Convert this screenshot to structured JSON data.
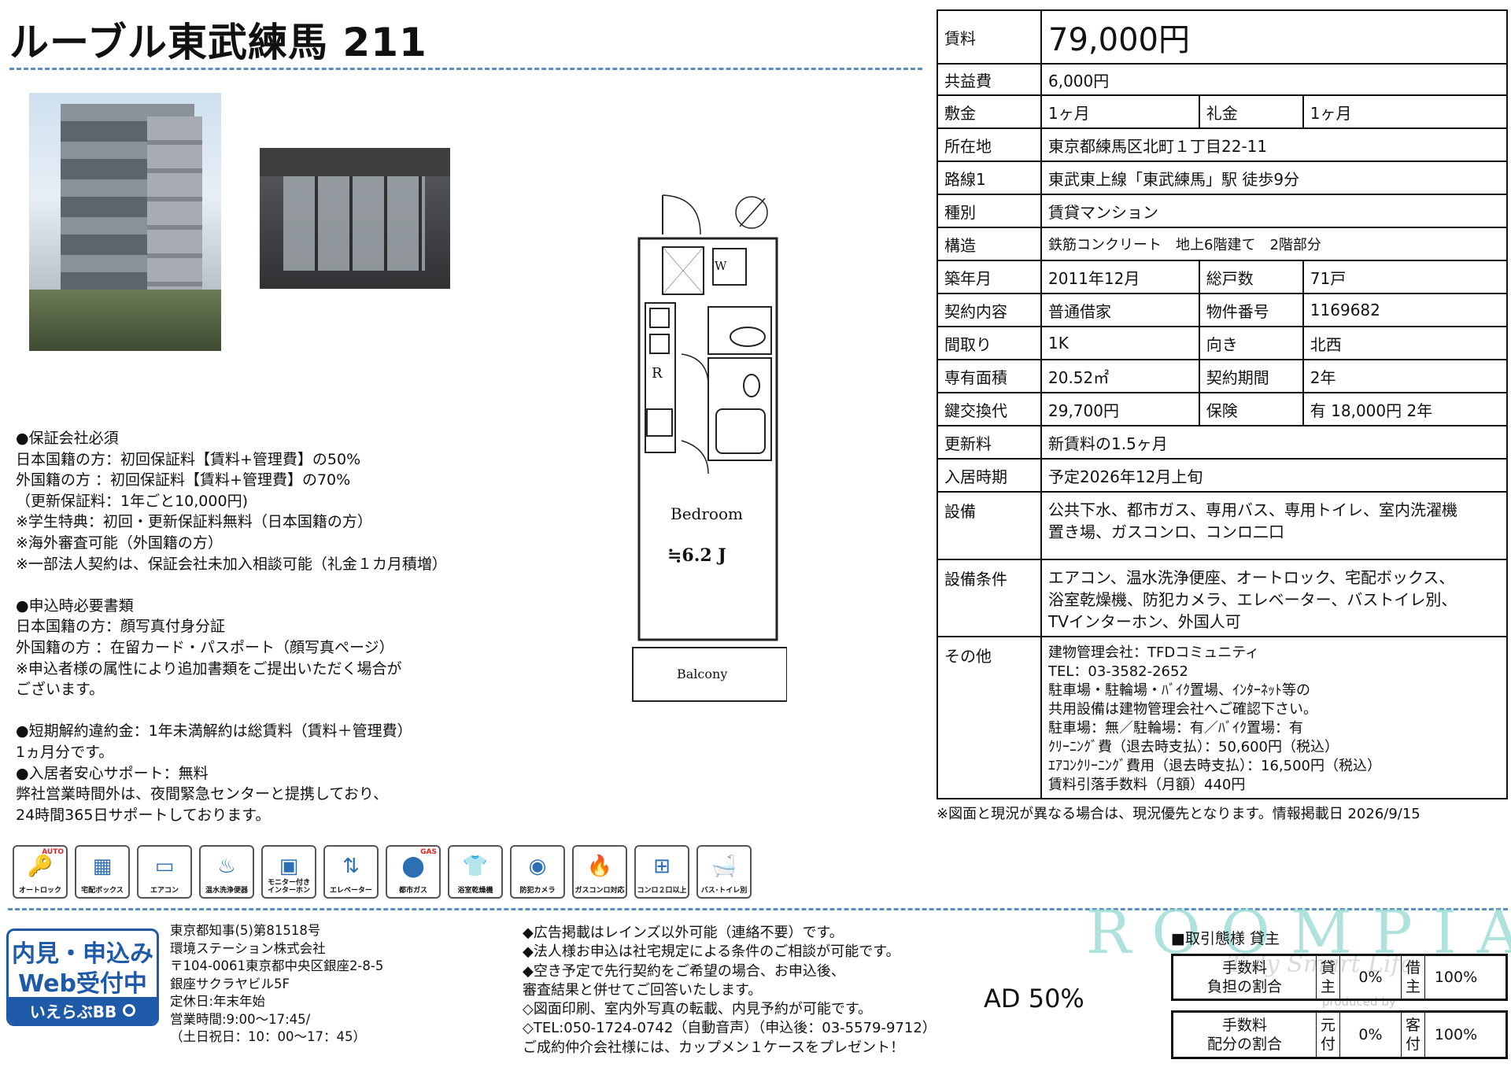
{
  "title": "ルーブル東武練馬 211",
  "specs": {
    "rent_label": "賃料",
    "rent_value": "79,000円",
    "common_fee_label": "共益費",
    "common_fee_value": "6,000円",
    "deposit_label": "敷金",
    "deposit_value": "1ヶ月",
    "key_money_label": "礼金",
    "key_money_value": "1ヶ月",
    "address_label": "所在地",
    "address_value": "東京都練馬区北町１丁目22-11",
    "route_label": "路線1",
    "route_value": "東武東上線「東武練馬」駅 徒歩9分",
    "type_label": "種別",
    "type_value": "賃貸マンション",
    "structure_label": "構造",
    "structure_value": "鉄筋コンクリート　地上6階建て　2階部分",
    "built_label": "築年月",
    "built_value": "2011年12月",
    "units_label": "総戸数",
    "units_value": "71戸",
    "contract_label": "契約内容",
    "contract_value": "普通借家",
    "property_no_label": "物件番号",
    "property_no_value": "1169682",
    "layout_label": "間取り",
    "layout_value": "1K",
    "direction_label": "向き",
    "direction_value": "北西",
    "area_label": "専有面積",
    "area_value": "20.52㎡",
    "period_label": "契約期間",
    "period_value": "2年",
    "key_exchange_label": "鍵交換代",
    "key_exchange_value": "29,700円",
    "insurance_label": "保険",
    "insurance_value": "有 18,000円 2年",
    "renewal_label": "更新料",
    "renewal_value": "新賃料の1.5ヶ月",
    "move_in_label": "入居時期",
    "move_in_value": "予定2026年12月上旬",
    "facilities_label": "設備",
    "facilities_value": "公共下水、都市ガス、専用バス、専用トイレ、室内洗濯機\n置き場、ガスコンロ、コンロ二口",
    "conditions_label": "設備条件",
    "conditions_value": "エアコン、温水洗浄便座、オートロック、宅配ボックス、\n浴室乾燥機、防犯カメラ、エレベーター、バストイレ別、\nTVインターホン、外国人可",
    "other_label": "その他",
    "other_value": "建物管理会社：TFDコミュニティ\nTEL：03-3582-2652\n駐車場・駐輪場・ﾊﾞｲｸ置場、ｲﾝﾀｰﾈｯﾄ等の\n共用設備は建物管理会社へご確認下さい。\n駐車場：無／駐輪場：有／ﾊﾞｲｸ置場：有\nｸﾘｰﾆﾝｸﾞ費（退去時支払）：50,600円（税込）\nｴｱｺﾝｸﾘｰﾆﾝｸﾞ費用（退去時支払）：16,500円（税込）\n賃料引落手数料（月額）440円"
  },
  "notice": "※図面と現況が異なる場合は、現況優先となります。情報掲載日 2026/9/15",
  "left_notes": "●保証会社必須\n日本国籍の方：初回保証料【賃料+管理費】の50%\n外国籍の方 ：初回保証料【賃料+管理費】の70%\n（更新保証料：1年ごと10,000円)\n※学生特典：初回・更新保証料無料（日本国籍の方）\n※海外審査可能（外国籍の方）\n※一部法人契約は、保証会社未加入相談可能（礼金１カ月積増）\n\n●申込時必要書類\n日本国籍の方：顔写真付身分証\n外国籍の方 ：在留カード・パスポート（顔写真ページ）\n※申込者様の属性により追加書類をご提出いただく場合が\nございます。\n\n●短期解約違約金：1年未満解約は総賃料（賃料＋管理費）\n1ヵ月分です。\n●入居者安心サポート：無料\n弊社営業時間外は、夜間緊急センターと提携しており、\n24時間365日サポートしております。",
  "floorplan": {
    "room_label": "Bedroom",
    "room_size": "≒6.2 J",
    "balcony_label": "Balcony",
    "r_label": "R",
    "w_label": "W"
  },
  "icons": [
    {
      "label": "オートロック",
      "icon": "key-icon",
      "glyph": "🔑",
      "badge": "AUTO"
    },
    {
      "label": "宅配ボックス",
      "icon": "delivery-box-icon",
      "glyph": "▦"
    },
    {
      "label": "エアコン",
      "icon": "air-conditioner-icon",
      "glyph": "▭"
    },
    {
      "label": "温水洗浄便器",
      "icon": "washlet-icon",
      "glyph": "♨"
    },
    {
      "label": "モニター付き\nインターホン",
      "icon": "intercom-icon",
      "glyph": "▣"
    },
    {
      "label": "エレベーター",
      "icon": "elevator-icon",
      "glyph": "⇅"
    },
    {
      "label": "都市ガス",
      "icon": "gas-tank-icon",
      "glyph": "⬤",
      "badge": "GAS"
    },
    {
      "label": "浴室乾燥機",
      "icon": "bath-dryer-icon",
      "glyph": "👕"
    },
    {
      "label": "防犯カメラ",
      "icon": "security-camera-icon",
      "glyph": "◉"
    },
    {
      "label": "ガスコンロ対応",
      "icon": "gas-flame-icon",
      "glyph": "🔥"
    },
    {
      "label": "コンロ２口以上",
      "icon": "stove-icon",
      "glyph": "⊞"
    },
    {
      "label": "バス･トイレ別",
      "icon": "bath-toilet-icon",
      "glyph": "🛁"
    }
  ],
  "web_badge": {
    "line1": "内見・申込み",
    "line2": "Web受付中",
    "bar": "いえらぶBB"
  },
  "company": "東京都知事(5)第81518号\n環境ステーション株式会社\n〒104-0061東京都中央区銀座2-8-5\n銀座サクラヤビル5F\n定休日:年末年始\n営業時間:9:00～17:45/\n（土日祝日：10：00～17：45）",
  "ad_notes": "◆広告掲載はレインズ以外可能（連絡不要）です。\n◆法人様お申込は社宅規定による条件のご相談が可能です。\n◆空き予定で先行契約をご希望の場合、お申込後、\n審査結果と併せてご回答いたします。\n◇図面印刷、室内外写真の転載、内見予約が可能です。\n◇TEL:050-1724-0742（自動音声）（申込後：03-5579-9712）\nご成約仲介会社様には、カップメン１ケースをプレゼント！",
  "ad_value": "AD 50%",
  "watermark": {
    "brand": "ROOMPIA",
    "tagline": "Tidy Smart Life",
    "produced_by": "produced by"
  },
  "trade": {
    "title": "■取引態様 貸主",
    "fee_burden_label": "手数料\n負担の割合",
    "landlord_label": "貸\n主",
    "landlord_pct": "0%",
    "tenant_label": "借\n主",
    "tenant_pct": "100%",
    "fee_split_label": "手数料\n配分の割合",
    "source_label": "元\n付",
    "source_pct": "0%",
    "client_label": "客\n付",
    "client_pct": "100%"
  },
  "colors": {
    "accent_blue": "#1e5aa8",
    "rule_blue": "#5b8ec0",
    "watermark_teal": "#8fd6d0"
  }
}
